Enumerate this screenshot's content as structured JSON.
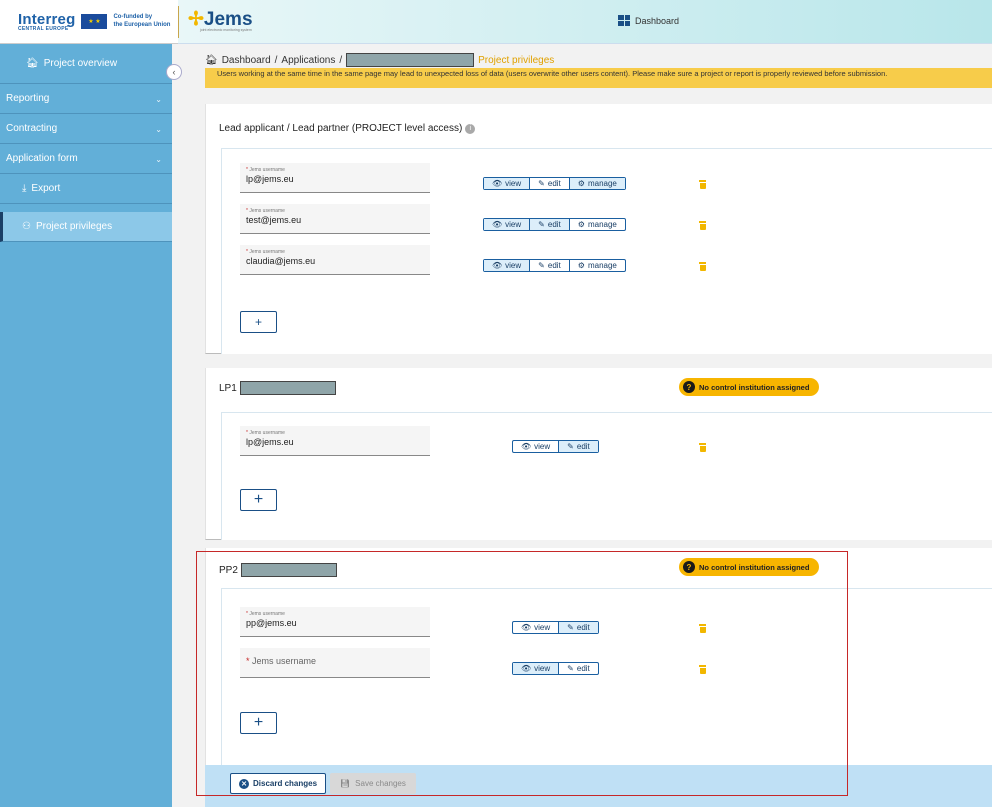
{
  "header": {
    "interreg_title": "Interreg",
    "interreg_subtitle": "CENTRAL EUROPE",
    "eu_text_line1": "Co-funded by",
    "eu_text_line2": "the European Union",
    "app_name": "Jems",
    "app_tagline": "joint electronic monitoring system",
    "dashboard_label": "Dashboard"
  },
  "sidebar": {
    "project_overview": "Project overview",
    "items": [
      {
        "label": "Reporting"
      },
      {
        "label": "Contracting"
      },
      {
        "label": "Application form"
      }
    ],
    "export": "Export",
    "project_privileges": "Project privileges"
  },
  "breadcrumb": {
    "dashboard": "Dashboard",
    "applications": "Applications",
    "current": "Project privileges"
  },
  "warning_text": "Users working at the same time in the same page may lead to unexpected loss of data (users overwrite other users content). Please make sure a project or report is properly reviewed before submission.",
  "lead_section": {
    "title": "Lead applicant / Lead partner (PROJECT level access)",
    "field_label": "Jems username",
    "users": [
      {
        "username": "lp@jems.eu",
        "active": "view"
      },
      {
        "username": "test@jems.eu",
        "active": "edit"
      },
      {
        "username": "claudia@jems.eu",
        "active": "view"
      }
    ],
    "toggle_labels": {
      "view": "view",
      "edit": "edit",
      "manage": "manage"
    },
    "add_label": "+"
  },
  "lp1_section": {
    "prefix": "LP1",
    "badge": "No control institution assigned",
    "field_label": "Jems username",
    "users": [
      {
        "username": "lp@jems.eu",
        "active": "edit"
      }
    ],
    "add_label": "+"
  },
  "pp2_section": {
    "prefix": "PP2",
    "badge": "No control institution assigned",
    "field_label": "Jems username",
    "users": [
      {
        "username": "pp@jems.eu",
        "active": "edit"
      }
    ],
    "empty_placeholder": "Jems username",
    "add_label": "+"
  },
  "footer": {
    "discard": "Discard changes",
    "save": "Save changes"
  },
  "colors": {
    "sidebar": "#62afd8",
    "accent": "#f7b500",
    "primary": "#1a4f86",
    "highlight": "#c62828"
  }
}
